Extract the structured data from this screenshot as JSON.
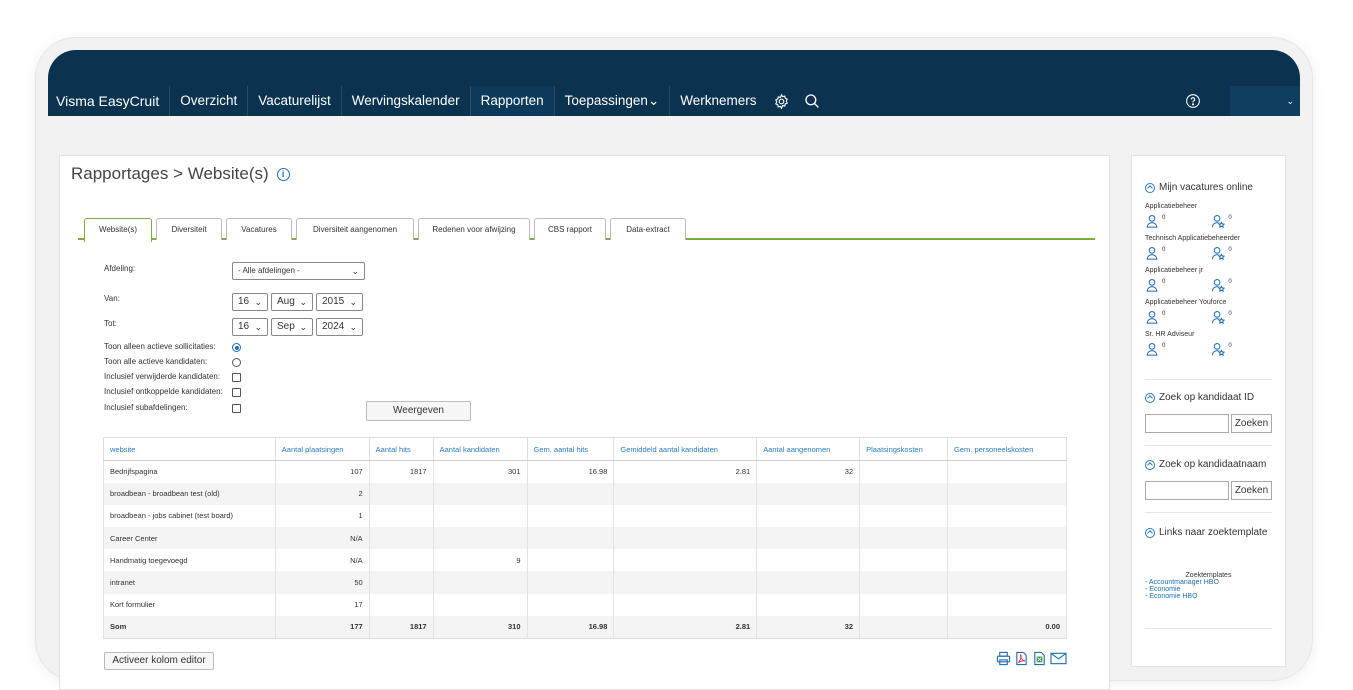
{
  "nav": {
    "brand": "Visma EasyCruit",
    "items": [
      "Overzicht",
      "Vacaturelijst",
      "Wervingskalender",
      "Rapporten",
      "Toepassingen⌄",
      "Werknemers"
    ],
    "user_caret": "⌄"
  },
  "page": {
    "title": "Rapportages > Website(s)"
  },
  "tabs": [
    "Website(s)",
    "Diversiteit",
    "Vacatures",
    "Diversiteit aangenomen",
    "Redenen voor afwijzing",
    "CBS rapport",
    "Data-extract"
  ],
  "form": {
    "afdeling_label": "Afdeling:",
    "afdeling_value": "- Alle afdelingen -",
    "van_label": "Van:",
    "van_day": "16",
    "van_month": "Aug",
    "van_year": "2015",
    "tot_label": "Tot:",
    "tot_day": "16",
    "tot_month": "Sep",
    "tot_year": "2024",
    "opt1": "Toon alleen actieve sollicitaties:",
    "opt2": "Toon alle actieve kandidaten:",
    "opt3": "Inclusief verwijderde kandidaten:",
    "opt4": "Inclusief ontkoppelde kandidaten:",
    "opt5": "Inclusief subafdelingen:",
    "submit": "Weergeven"
  },
  "table": {
    "headers": [
      "website",
      "Aantal plaatsingen",
      "Aantal hits",
      "Aantal kandidaten",
      "Gem. aantal hits",
      "Gemiddeld aantal kandidaten",
      "Aantal aangenomen",
      "Plaatsingskosten",
      "Gem. personeelskosten"
    ],
    "rows": [
      [
        "Bedrijfspagina",
        "107",
        "1817",
        "301",
        "16.98",
        "2.81",
        "32",
        "",
        ""
      ],
      [
        "broadbean - broadbean test (old)",
        "2",
        "",
        "",
        "",
        "",
        "",
        "",
        ""
      ],
      [
        "broadbean - jobs cabinet (test board)",
        "1",
        "",
        "",
        "",
        "",
        "",
        "",
        ""
      ],
      [
        "Career Center",
        "N/A",
        "",
        "",
        "",
        "",
        "",
        "",
        ""
      ],
      [
        "Handmatig toegevoegd",
        "N/A",
        "",
        "9",
        "",
        "",
        "",
        "",
        ""
      ],
      [
        "intranet",
        "50",
        "",
        "",
        "",
        "",
        "",
        "",
        ""
      ],
      [
        "Kort formulier",
        "17",
        "",
        "",
        "",
        "",
        "",
        "",
        ""
      ]
    ],
    "sum": [
      "Som",
      "177",
      "1817",
      "310",
      "16.98",
      "2.81",
      "32",
      "",
      "0.00"
    ]
  },
  "kolom_editor": "Activeer kolom editor",
  "sidebar": {
    "vacatures_title": "Mijn vacatures online",
    "vacatures": [
      {
        "name": "Applicatiebeheer",
        "a": "0",
        "b": "0"
      },
      {
        "name": "Technisch Applicatiebeheerder",
        "a": "0",
        "b": "0"
      },
      {
        "name": "Applicatiebeheer jr",
        "a": "0",
        "b": "0"
      },
      {
        "name": "Applicatiebeheer Youforce",
        "a": "0",
        "b": "0"
      },
      {
        "name": "Sr. HR Adviseur",
        "a": "0",
        "b": "0"
      }
    ],
    "zoek_id_title": "Zoek op kandidaat ID",
    "zoek_naam_title": "Zoek op kandidaatnaam",
    "zoek_button": "Zoeken",
    "links_title": "Links naar zoektemplate",
    "zoektemplates_title": "Zoektemplates",
    "zoektemplates": [
      "- Accountmanager HBO",
      "- Economie",
      "- Economie HBO"
    ]
  },
  "colors": {
    "navy": "#0b3350",
    "accent_green": "#7cae3b",
    "link_blue": "#2a7bbf"
  }
}
